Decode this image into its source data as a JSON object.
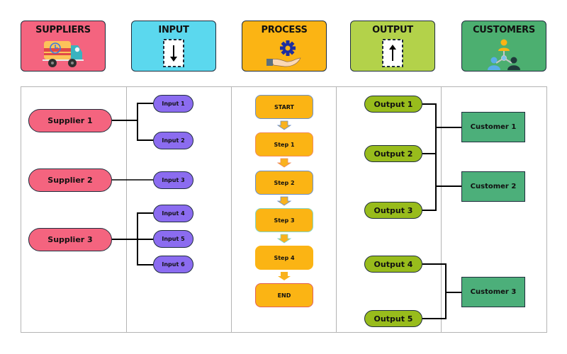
{
  "headers": {
    "suppliers": {
      "title": "SUPPLIERS",
      "icon": "delivery-truck-icon",
      "color": "#f4647f"
    },
    "input": {
      "title": "INPUT",
      "icon": "down-arrow-icon",
      "color": "#5bd8ee"
    },
    "process": {
      "title": "PROCESS",
      "icon": "gear-hand-icon",
      "color": "#fbb414"
    },
    "output": {
      "title": "OUTPUT",
      "icon": "up-arrow-icon",
      "color": "#b3d24a"
    },
    "customers": {
      "title": "CUSTOMERS",
      "icon": "people-network-icon",
      "color": "#4caf70"
    }
  },
  "suppliers": [
    "Supplier 1",
    "Supplier 2",
    "Supplier 3"
  ],
  "inputs": [
    "Input 1",
    "Input 2",
    "Input 3",
    "Input 4",
    "Input 5",
    "Input 6"
  ],
  "process_steps": [
    "START",
    "Step 1",
    "Step 2",
    "Step 3",
    "Step 4",
    "END"
  ],
  "outputs": [
    "Output 1",
    "Output 2",
    "Output 3",
    "Output 4",
    "Output 5"
  ],
  "customers": [
    "Customer 1",
    "Customer 2",
    "Customer 3"
  ],
  "connections": {
    "supplier_to_inputs": {
      "Supplier 1": [
        "Input 1",
        "Input 2"
      ],
      "Supplier 2": [
        "Input 3"
      ],
      "Supplier 3": [
        "Input 4",
        "Input 5",
        "Input 6"
      ]
    },
    "outputs_to_customers": {
      "Customer 1": [
        "Output 1",
        "Output 2"
      ],
      "Customer 2": [
        "Output 2",
        "Output 3"
      ],
      "Customer 3": [
        "Output 4",
        "Output 5"
      ]
    }
  }
}
